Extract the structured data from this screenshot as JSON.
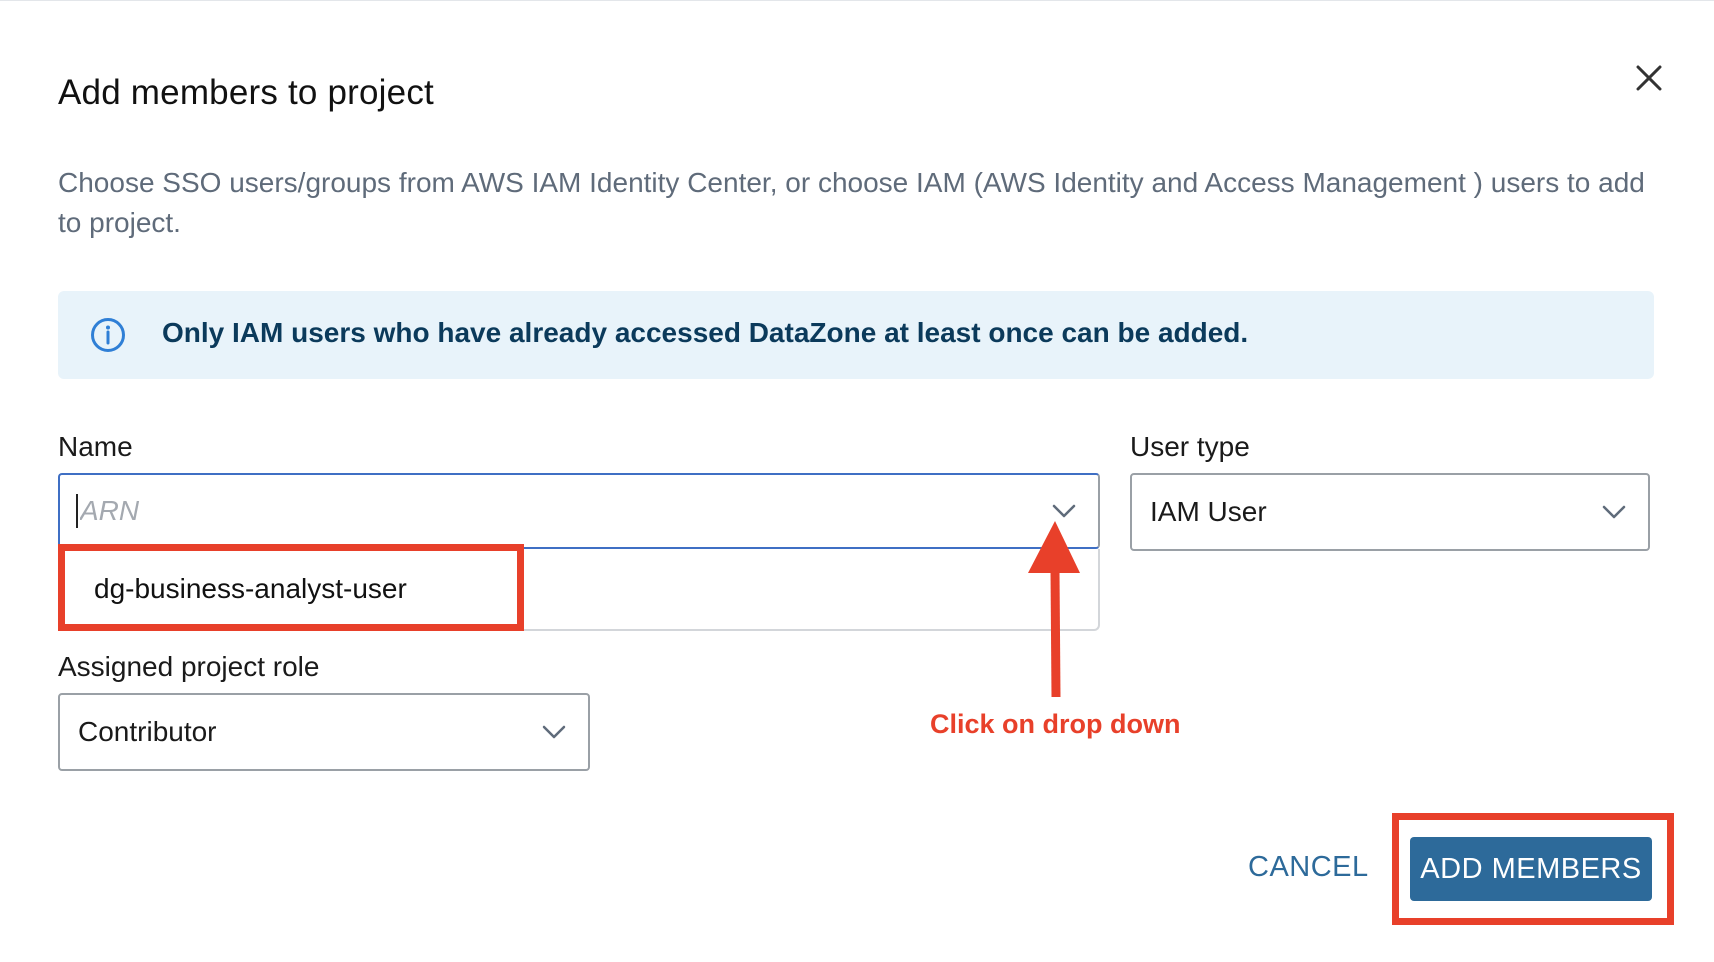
{
  "dialog": {
    "title": "Add members to project",
    "description": "Choose SSO users/groups from AWS IAM Identity Center, or choose IAM (AWS Identity and Access Management ) users to add to project."
  },
  "info_banner": {
    "text": "Only IAM users who have already accessed DataZone at least once can be added.",
    "icon": "info-icon"
  },
  "form": {
    "name": {
      "label": "Name",
      "placeholder": "ARN",
      "value": "",
      "options": [
        "dg-business-analyst-user"
      ]
    },
    "user_type": {
      "label": "User type",
      "value": "IAM User"
    },
    "role": {
      "label": "Assigned project role",
      "value": "Contributor"
    }
  },
  "annotation": {
    "text": "Click on drop down",
    "color": "#e8402a"
  },
  "buttons": {
    "cancel": "CANCEL",
    "add": "ADD MEMBERS"
  },
  "colors": {
    "primary": "#2d6a9a",
    "banner_bg": "#e8f3fa",
    "banner_text": "#0b3a5b",
    "highlight": "#e8402a"
  }
}
